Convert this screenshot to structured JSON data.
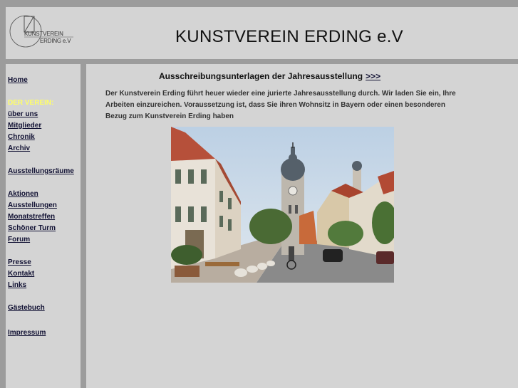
{
  "header": {
    "logo_line1": "KUNSTVEREIN",
    "logo_line2": "ERDING e.V",
    "title": "KUNSTVEREIN ERDING e.V"
  },
  "nav": {
    "items": [
      {
        "label": "Home",
        "type": "link"
      },
      {
        "label": "DER VEREIN:",
        "type": "section"
      },
      {
        "label": "über uns",
        "type": "link"
      },
      {
        "label": "Mitglieder",
        "type": "link"
      },
      {
        "label": "Chronik",
        "type": "link"
      },
      {
        "label": "Archiv",
        "type": "link"
      },
      {
        "label": "Ausstellungsräume",
        "type": "link"
      },
      {
        "label": "Aktionen",
        "type": "link"
      },
      {
        "label": "Ausstellungen",
        "type": "link"
      },
      {
        "label": "Monatstreffen",
        "type": "link"
      },
      {
        "label": "Schöner Turm",
        "type": "link"
      },
      {
        "label": "Forum",
        "type": "link"
      },
      {
        "label": "Presse",
        "type": "link"
      },
      {
        "label": "Kontakt",
        "type": "link"
      },
      {
        "label": "Links",
        "type": "link"
      },
      {
        "label": "Gästebuch",
        "type": "link"
      },
      {
        "label": "Impressum",
        "type": "link"
      }
    ]
  },
  "main": {
    "heading": "Ausschreibungsunterlagen der Jahresausstellung",
    "heading_link": ">>>",
    "intro": "Der Kunstverein Erding führt heuer wieder eine jurierte Jahresausstellung durch. Wir laden Sie ein, Ihre Arbeiten einzureichen. Voraussetzung ist, dass Sie ihren Wohnsitz in Bayern oder einen besonderen Bezug zum Kunstverein Erding haben"
  },
  "colors": {
    "page_bg": "#9c9c9c",
    "panel_bg": "#d4d4d4",
    "section_label": "#ffff66",
    "link": "#111133"
  }
}
